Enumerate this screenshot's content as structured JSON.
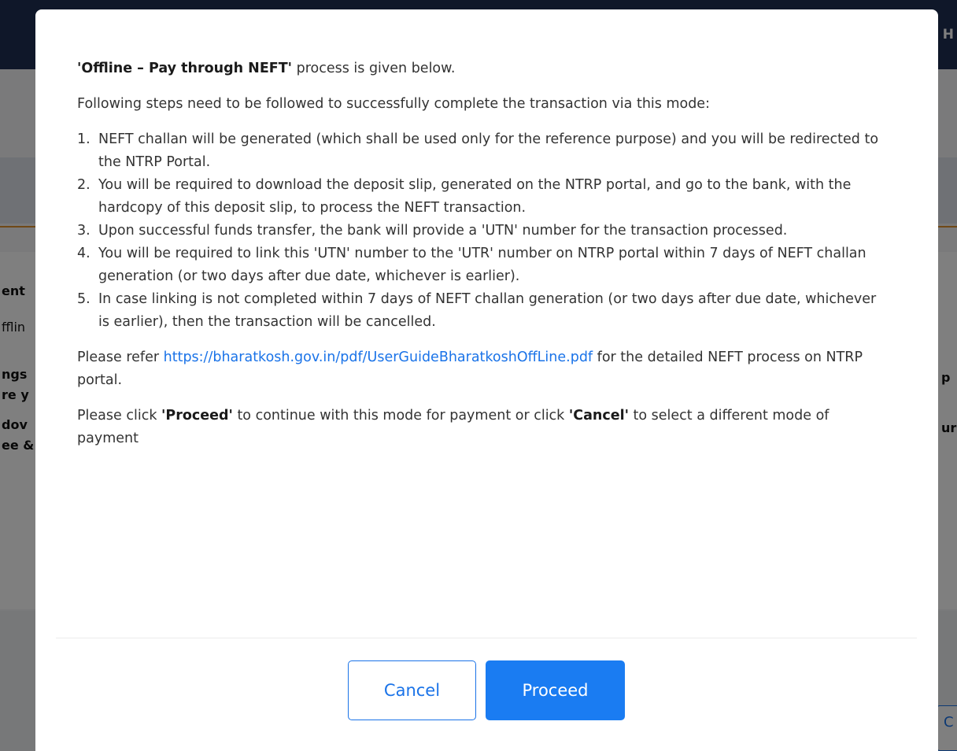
{
  "background": {
    "header_fragment": "H",
    "left_fragments": [
      "ent",
      "fflin",
      "ngs",
      "re y",
      "dov",
      "ee &"
    ],
    "right_fragments": [
      "p",
      "ur"
    ],
    "right_button_fragment": "C"
  },
  "modal": {
    "intro": {
      "bold": "'Offline – Pay through NEFT'",
      "rest": " process is given below."
    },
    "steps_intro": "Following steps need to be followed to successfully complete the transaction via this mode:",
    "steps": [
      {
        "num": "1.",
        "text": "NEFT challan will be generated (which shall be used only for the reference purpose) and you will be redirected to the NTRP Portal."
      },
      {
        "num": "2.",
        "text": "You will be required to download the deposit slip, generated on the NTRP portal, and go to the bank, with the hardcopy of this deposit slip, to process the NEFT transaction."
      },
      {
        "num": "3.",
        "text": "Upon successful funds transfer, the bank will provide a 'UTN' number for the transaction processed."
      },
      {
        "num": "4.",
        "text": "You will be required to link this 'UTN' number to the 'UTR' number on NTRP portal within 7 days of NEFT challan generation (or two days after due date, whichever is earlier)."
      },
      {
        "num": "5.",
        "text": "In case linking is not completed within 7 days of NEFT challan generation (or two days after due date, whichever is earlier), then the transaction will be cancelled."
      }
    ],
    "refer": {
      "prefix": "Please refer ",
      "link": "https://bharatkosh.gov.in/pdf/UserGuideBharatkoshOffLine.pdf",
      "suffix": " for the detailed NEFT process on NTRP portal."
    },
    "instruction": {
      "part1": "Please click ",
      "proceed_word": "'Proceed'",
      "part2": " to continue with this mode for payment or click ",
      "cancel_word": "'Cancel'",
      "part3": " to select a different mode of payment"
    },
    "buttons": {
      "cancel": "Cancel",
      "proceed": "Proceed"
    }
  },
  "colors": {
    "accent": "#1a73e8",
    "primary_button": "#1a7cf2",
    "header": "#1f2f52",
    "divider_orange": "#e0922f"
  }
}
